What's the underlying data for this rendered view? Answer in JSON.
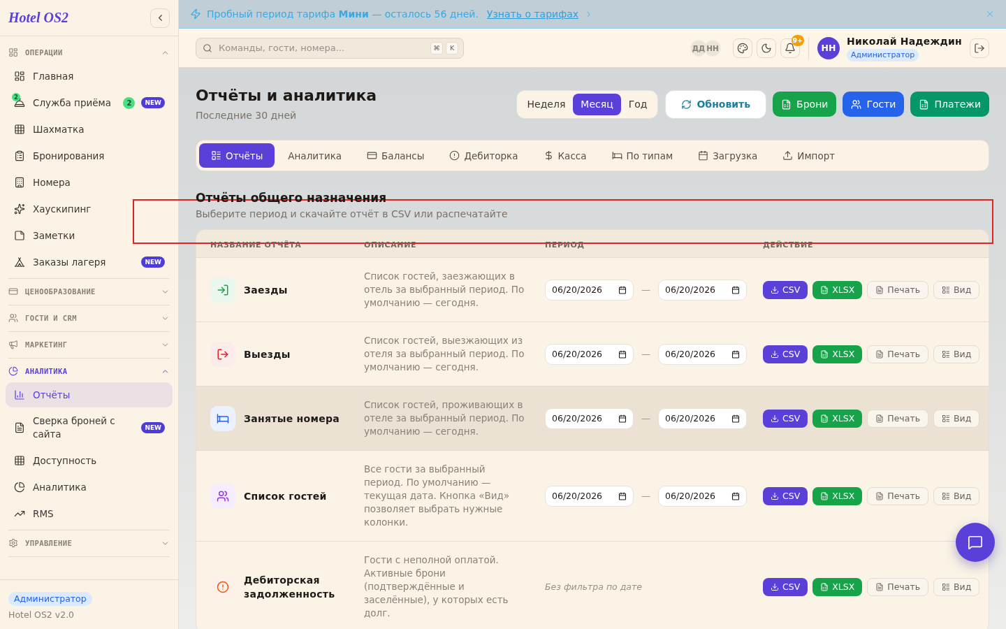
{
  "sidebar": {
    "logo": "Hotel OS2",
    "sections": [
      {
        "title": "ОПЕРАЦИИ",
        "expanded": true,
        "items": [
          {
            "label": "Главная",
            "selected": false
          },
          {
            "label": "Служба приёма",
            "selected": false,
            "icon_badge": "2",
            "count": "2",
            "badge": "NEW"
          },
          {
            "label": "Шахматка",
            "selected": false
          },
          {
            "label": "Бронирования",
            "selected": false
          },
          {
            "label": "Номера",
            "selected": false
          },
          {
            "label": "Хаускипинг",
            "selected": false
          },
          {
            "label": "Заметки",
            "selected": false
          },
          {
            "label": "Заказы лагеря",
            "selected": false,
            "badge": "NEW"
          }
        ]
      },
      {
        "title": "ЦЕНООБРАЗОВАНИЕ",
        "expanded": false
      },
      {
        "title": "ГОСТИ И CRM",
        "expanded": false
      },
      {
        "title": "МАРКЕТИНГ",
        "expanded": false
      },
      {
        "title": "АНАЛИТИКА",
        "expanded": true,
        "items": [
          {
            "label": "Отчёты",
            "selected": true
          },
          {
            "label": "Сверка броней с сайта",
            "selected": false,
            "badge": "NEW"
          },
          {
            "label": "Доступность",
            "selected": false
          },
          {
            "label": "Аналитика",
            "selected": false
          },
          {
            "label": "RMS",
            "selected": false
          }
        ]
      },
      {
        "title": "УПРАВЛЕНИЕ",
        "expanded": false
      }
    ],
    "footer": {
      "role": "Администратор",
      "version": "Hotel OS2 v2.0"
    }
  },
  "banner": {
    "text": "Пробный период тарифа **Мини** — осталось 56 дней.",
    "link": "Узнать о тарифах"
  },
  "topbar": {
    "search": {
      "placeholder": "Команды, гости, номера...",
      "keys": [
        "⌘",
        "K"
      ]
    },
    "presence": [
      "ДД",
      "НН"
    ],
    "notifications": "9+",
    "user": {
      "initials": "НН",
      "name": "Николай Надеждин",
      "role": "Администратор"
    }
  },
  "page_header": {
    "title": "Отчёты и аналитика",
    "subtitle": "Последние 30 дней",
    "periods": [
      {
        "label": "Неделя",
        "selected": false
      },
      {
        "label": "Месяц",
        "selected": true
      },
      {
        "label": "Год",
        "selected": false
      }
    ],
    "actions": [
      {
        "label": "Обновить",
        "kind": "outline",
        "color": "#1b7f9e"
      },
      {
        "label": "Брони",
        "kind": "solid",
        "color": "#16a34a"
      },
      {
        "label": "Гости",
        "kind": "solid",
        "color": "#2563eb"
      },
      {
        "label": "Платежи",
        "kind": "solid",
        "color": "#059669"
      }
    ]
  },
  "tabs": [
    {
      "label": "Отчёты",
      "selected": true
    },
    {
      "label": "Аналитика",
      "selected": false
    },
    {
      "label": "Балансы",
      "selected": false
    },
    {
      "label": "Дебиторка",
      "selected": false
    },
    {
      "label": "Касса",
      "selected": false
    },
    {
      "label": "По типам",
      "selected": false
    },
    {
      "label": "Загрузка",
      "selected": false
    },
    {
      "label": "Импорт",
      "selected": false
    }
  ],
  "reports": {
    "title": "Отчёты общего назначения",
    "subtitle": "Выберите период и скачайте отчёт в CSV или распечатайте",
    "columns": [
      "НАЗВАНИЕ ОТЧЁТА",
      "ОПИСАНИЕ",
      "ПЕРИОД",
      "ДЕЙСТВИЕ"
    ],
    "rows": [
      {
        "name": "Заезды",
        "highlighted": false,
        "description": "Список гостей, заезжающих в отель за выбранный период. По умолчанию — сегодня.",
        "period": {
          "kind": "range",
          "from": "06/20/2026",
          "separator": "—",
          "to": "06/20/2026"
        },
        "actions": [
          {
            "label": "CSV",
            "kind": "csv"
          },
          {
            "label": "XLSX",
            "kind": "xlsx"
          },
          {
            "label": "Печать",
            "kind": "print"
          },
          {
            "label": "Вид",
            "kind": "view"
          }
        ]
      },
      {
        "name": "Выезды",
        "highlighted": false,
        "description": "Список гостей, выезжающих из отеля за выбранный период. По умолчанию — сегодня.",
        "period": {
          "kind": "range",
          "from": "06/20/2026",
          "separator": "—",
          "to": "06/20/2026"
        },
        "actions": [
          {
            "label": "CSV",
            "kind": "csv"
          },
          {
            "label": "XLSX",
            "kind": "xlsx"
          },
          {
            "label": "Печать",
            "kind": "print"
          },
          {
            "label": "Вид",
            "kind": "view"
          }
        ]
      },
      {
        "name": "Занятые номера",
        "highlighted": true,
        "description": "Список гостей, проживающих в отеле за выбранный период. По умолчанию — сегодня.",
        "period": {
          "kind": "range",
          "from": "06/20/2026",
          "separator": "—",
          "to": "06/20/2026"
        },
        "actions": [
          {
            "label": "CSV",
            "kind": "csv"
          },
          {
            "label": "XLSX",
            "kind": "xlsx"
          },
          {
            "label": "Печать",
            "kind": "print"
          },
          {
            "label": "Вид",
            "kind": "view"
          }
        ]
      },
      {
        "name": "Список гостей",
        "highlighted": false,
        "description": "Все гости за выбранный период. По умолчанию — текущая дата. Кнопка «Вид» позволяет выбрать нужные колонки.",
        "period": {
          "kind": "range",
          "from": "06/20/2026",
          "separator": "—",
          "to": "06/20/2026"
        },
        "actions": [
          {
            "label": "CSV",
            "kind": "csv"
          },
          {
            "label": "XLSX",
            "kind": "xlsx"
          },
          {
            "label": "Печать",
            "kind": "print"
          },
          {
            "label": "Вид",
            "kind": "view"
          }
        ]
      },
      {
        "name": "Дебиторская задолженность",
        "highlighted": false,
        "description": "Гости с неполной оплатой. Активные брони (подтверждённые и заселённые), у которых есть долг.",
        "period": {
          "kind": "none",
          "note": "Без фильтра по дате"
        },
        "actions": [
          {
            "label": "CSV",
            "kind": "csv"
          },
          {
            "label": "XLSX",
            "kind": "xlsx"
          },
          {
            "label": "Печать",
            "kind": "print"
          },
          {
            "label": "Вид",
            "kind": "view"
          }
        ]
      }
    ]
  }
}
